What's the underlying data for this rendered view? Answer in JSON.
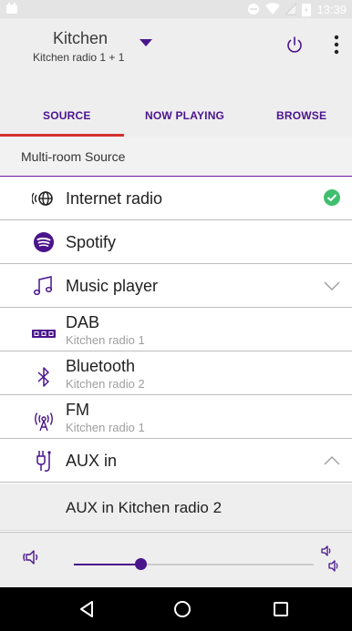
{
  "status_bar": {
    "time": "13:39"
  },
  "header": {
    "room_title": "Kitchen",
    "room_subtitle": "Kitchen radio 1 + 1"
  },
  "tabs": [
    {
      "label": "SOURCE",
      "active": true
    },
    {
      "label": "NOW PLAYING",
      "active": false
    },
    {
      "label": "BROWSE",
      "active": false
    }
  ],
  "section": {
    "title": "Multi-room Source"
  },
  "sources": [
    {
      "label": "Internet radio",
      "icon": "internet-radio-icon",
      "selected": true
    },
    {
      "label": "Spotify",
      "icon": "spotify-icon"
    },
    {
      "label": "Music player",
      "icon": "music-note-icon",
      "expand": "collapsed"
    },
    {
      "label": "DAB",
      "sublabel": "Kitchen radio 1",
      "icon": "dab-icon"
    },
    {
      "label": "Bluetooth",
      "sublabel": "Kitchen radio 2",
      "icon": "bluetooth-icon"
    },
    {
      "label": "FM",
      "sublabel": "Kitchen radio 1",
      "icon": "fm-antenna-icon"
    },
    {
      "label": "AUX in",
      "icon": "aux-plug-icon",
      "expand": "expanded"
    }
  ],
  "aux_expanded": {
    "label": "AUX in Kitchen radio 2"
  },
  "volume": {
    "level": 0.27
  },
  "colors": {
    "accent_purple": "#4a148c",
    "tab_indicator": "#d32f2f",
    "selected_check": "#3fbf6f"
  }
}
